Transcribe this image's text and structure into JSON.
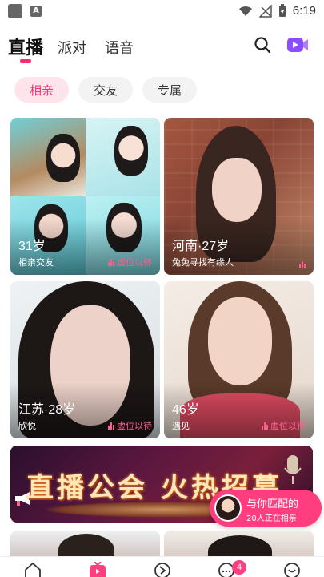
{
  "status_bar": {
    "time": "6:19",
    "icons": [
      "app-icon",
      "notification-a-icon",
      "wifi-icon",
      "no-signal-icon",
      "battery-icon"
    ]
  },
  "top_tabs": [
    {
      "label": "直播",
      "active": true
    },
    {
      "label": "派对",
      "active": false
    },
    {
      "label": "语音",
      "active": false
    }
  ],
  "top_icons": [
    "search-icon",
    "video-icon"
  ],
  "chips": [
    {
      "label": "相亲",
      "active": true
    },
    {
      "label": "交友",
      "active": false
    },
    {
      "label": "专属",
      "active": false
    }
  ],
  "cards": [
    {
      "title": "31岁",
      "subtitle": "相亲交友",
      "status": "虚位以待"
    },
    {
      "title": "河南·27岁",
      "subtitle": "兔兔寻找有缘人",
      "status": ""
    },
    {
      "title": "江苏·28岁",
      "subtitle": "欣悦",
      "status": "虚位以待"
    },
    {
      "title": "46岁",
      "subtitle": "遇见",
      "status": "虚位以待"
    }
  ],
  "banner": {
    "text": "直播公会 火热招募"
  },
  "match_pill": {
    "title": "与你匹配的",
    "subtitle": "20人正在相亲"
  },
  "bottom_nav": {
    "items": [
      "home-icon",
      "live-tv-icon",
      "discover-icon",
      "messages-icon",
      "profile-icon"
    ],
    "badge": "4"
  },
  "colors": {
    "accent": "#ff2d6f",
    "chip_bg": "#f3f3f3",
    "chip_active_bg": "#ffe4ec"
  }
}
